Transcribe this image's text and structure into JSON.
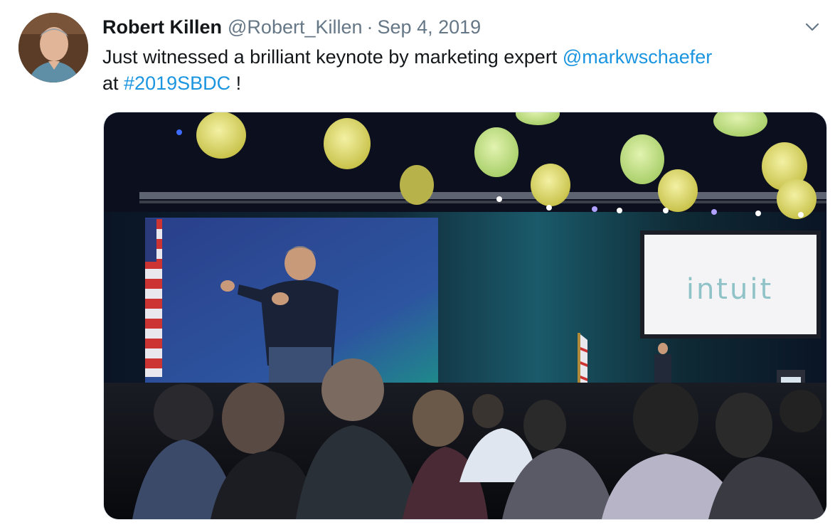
{
  "tweet": {
    "author_name": "Robert Killen",
    "author_handle": "@Robert_Killen",
    "separator": "·",
    "date": "Sep 4, 2019",
    "text_part1": "Just witnessed a brilliant keynote by marketing expert ",
    "mention": "@markwschaefer",
    "text_part2": " at ",
    "hashtag": "#2019SBDC",
    "text_part3": " !",
    "menu_icon": "chevron-down-icon"
  },
  "media": {
    "screen_text": "intuit",
    "colors": {
      "stage_dark": "#0b0f1e",
      "lantern": "#e6e27a",
      "screen_left": "#2b4a9a",
      "screen_right": "#f4f4f6"
    }
  }
}
